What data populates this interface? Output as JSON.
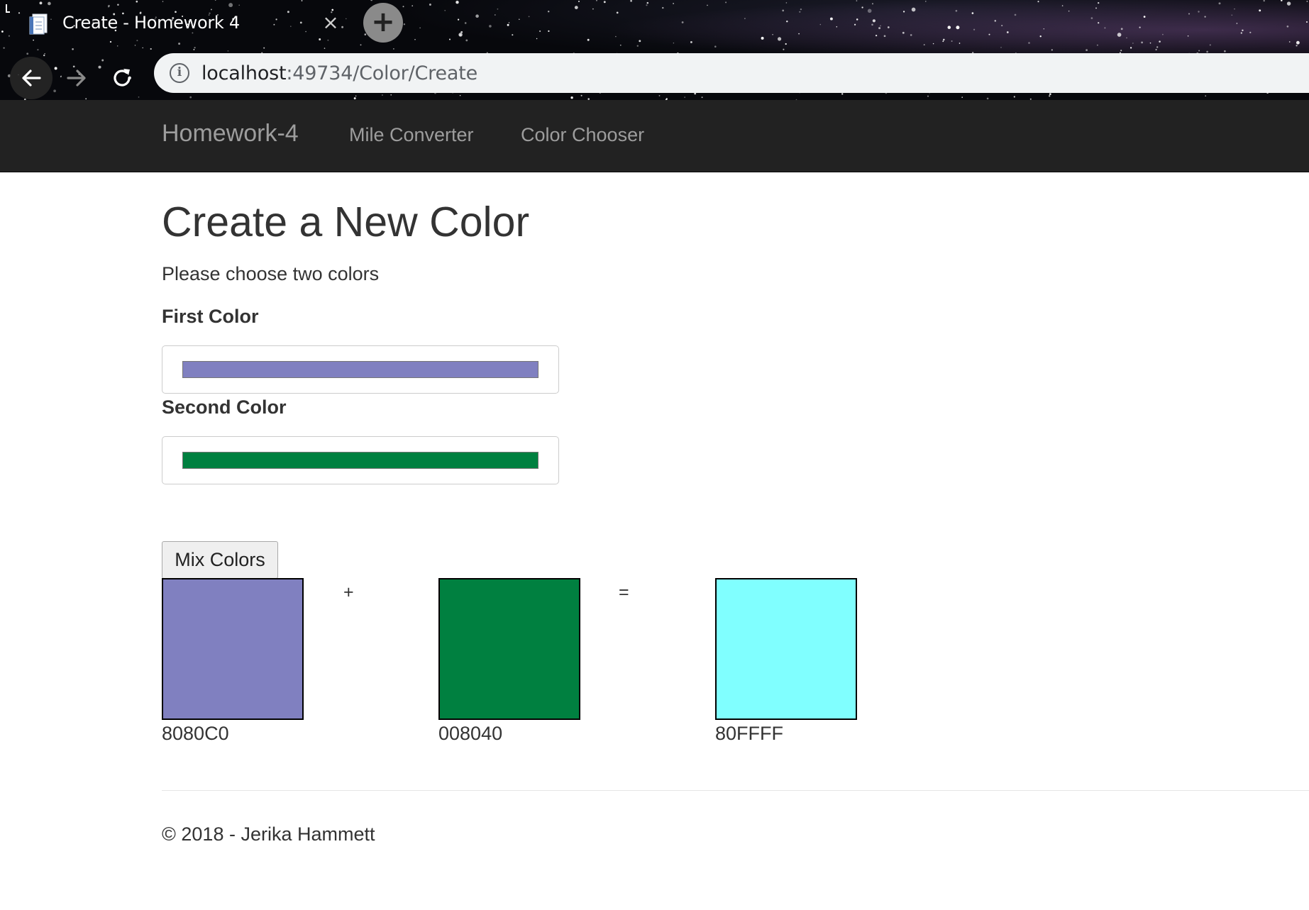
{
  "browser": {
    "tab_title": "Create - Homework 4",
    "tab_close_glyph": "×",
    "new_tab_glyph": "+",
    "url_host": "localhost",
    "url_path": ":49734/Color/Create",
    "info_glyph": "i"
  },
  "navbar": {
    "brand": "Homework-4",
    "links": [
      "Mile Converter",
      "Color Chooser"
    ]
  },
  "page": {
    "title": "Create a New Color",
    "subtitle": "Please choose two colors",
    "first_label": "First Color",
    "second_label": "Second Color",
    "first_color": "#8080C0",
    "second_color": "#008040",
    "mix_button": "Mix Colors",
    "plus": "+",
    "equals": "=",
    "result_color": "#80FFFF",
    "first_hex": "8080C0",
    "second_hex": "008040",
    "result_hex": "80FFFF"
  },
  "footer": {
    "text": "© 2018 - Jerika Hammett"
  },
  "colors": {
    "navbar_bg": "#222222",
    "navbar_text": "#9d9d9d",
    "body_text": "#333333"
  },
  "icons": {
    "favicon": "document-icon",
    "back": "back-arrow-icon",
    "forward": "forward-arrow-icon",
    "reload": "reload-icon",
    "info": "info-icon"
  }
}
